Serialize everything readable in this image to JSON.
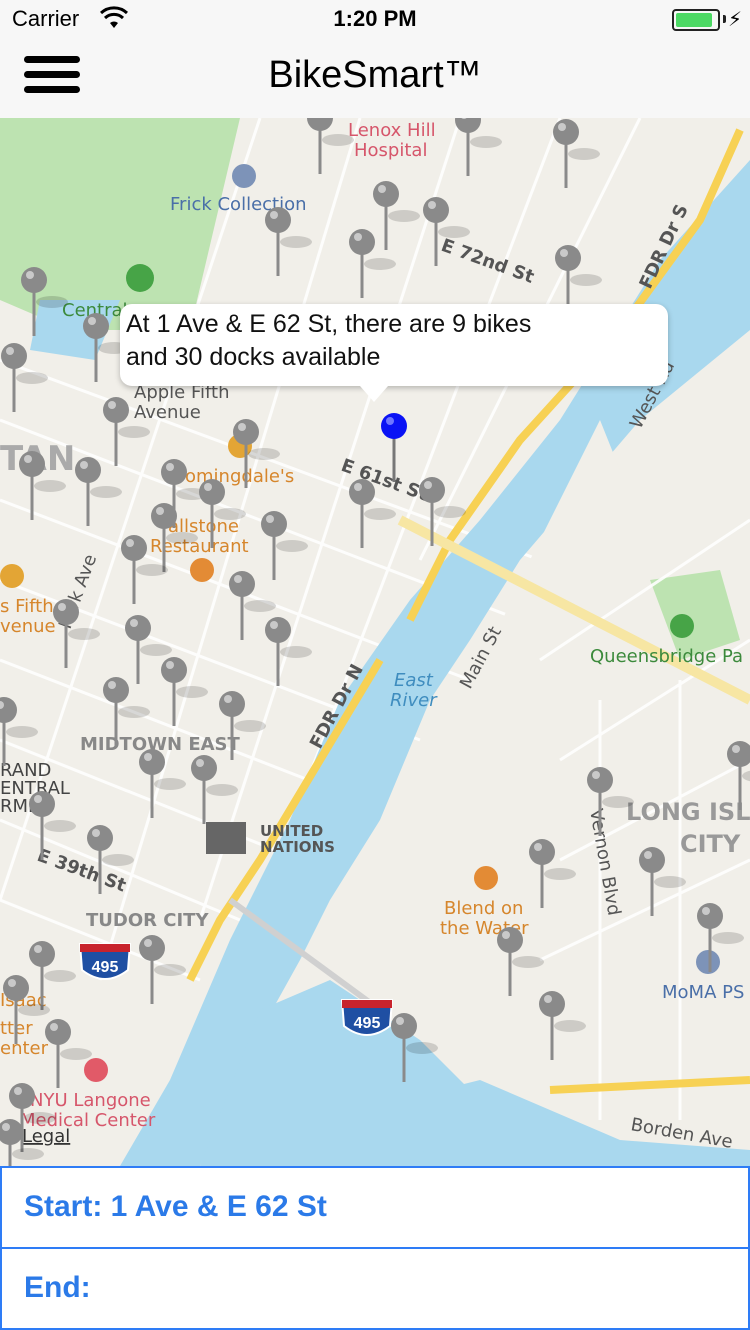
{
  "status": {
    "carrier": "Carrier",
    "time": "1:20 PM",
    "battery_level": 1.0
  },
  "nav": {
    "title": "BikeSmart™",
    "menu_icon": "hamburger-menu-icon"
  },
  "callout": {
    "line1": "At 1 Ave & E 62 St, there are 9 bikes",
    "line2": "and 30 docks available"
  },
  "map": {
    "labels": {
      "lenox": "Lenox Hill",
      "hospital": "Hospital",
      "frick": "Frick Collection",
      "central": "Central",
      "apple1": "Apple Fifth",
      "apple2": "Avenue",
      "bloomingdales": "oomingdale's",
      "smith1": "allstone",
      "smith2": "Restaurant",
      "fifth1": "s Fifth",
      "fifth2": "venue",
      "midtown": "MIDTOWN EAST",
      "un1": "UNITED",
      "un2": "NATIONS",
      "tudor": "TUDOR CITY",
      "nyu1": "NYU Langone",
      "nyu2": "Medical Center",
      "legal": "Legal",
      "blend1": "Blend on",
      "blend2": "the Water",
      "east_river1": "East",
      "east_river2": "River",
      "queensbridge": "Queensbridge Pa",
      "lic1": "LONG ISLA",
      "lic2": "CITY",
      "moma": "MoMA PS",
      "borden": "Borden Ave",
      "e72": "E 72nd St",
      "e61": "E 61st St",
      "e39": "E 39th St",
      "e62": "E 62 St",
      "fdr1": "FDR Dr S",
      "fdr2": "FDR Dr N",
      "main1": "Main St",
      "main2": "West Rd",
      "vernon": "Vernon Blvd",
      "park": "Park Ave",
      "i495": "495",
      "grand": "RAND",
      "central2": "ENTRAL",
      "terminal": "RMI",
      "isaac": "Isaac",
      "tter": "tter",
      "enter": "enter",
      "tan": "TAN"
    }
  },
  "form": {
    "start_label": "Start: 1 Ave & E 62 St",
    "end_label": "End:"
  },
  "colors": {
    "accent": "#2e7cf6",
    "water": "#a9d8ee",
    "park": "#bde3b1",
    "highway": "#f7d154",
    "selected_pin": "#0a12f5",
    "pin": "#8a8a8a"
  }
}
